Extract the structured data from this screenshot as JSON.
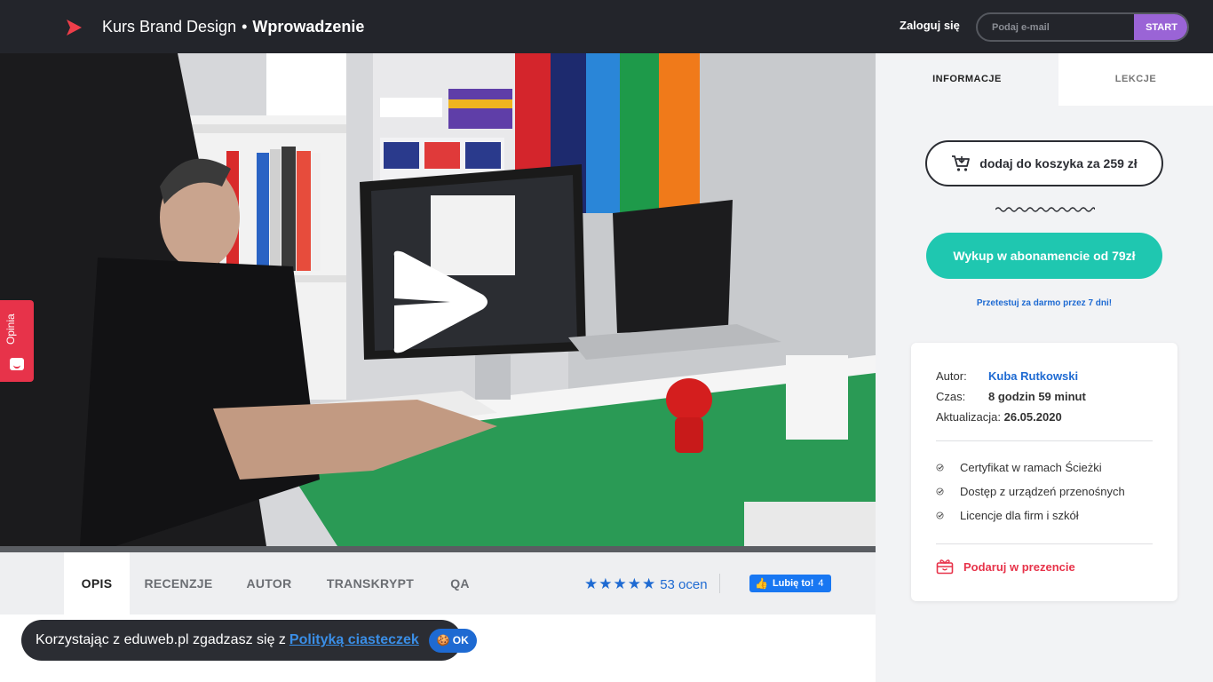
{
  "header": {
    "course_prefix": "Kurs Brand Design",
    "separator": "•",
    "course_section": "Wprowadzenie"
  },
  "auth": {
    "login_label": "Zaloguj się",
    "email_placeholder": "Podaj e-mail",
    "start_label": "START"
  },
  "video": {
    "play_icon": "play-icon"
  },
  "tabs": [
    {
      "label": "OPIS",
      "active": true
    },
    {
      "label": "RECENZJE",
      "active": false
    },
    {
      "label": "AUTOR",
      "active": false
    },
    {
      "label": "TRANSKRYPT",
      "active": false
    },
    {
      "label": "QA",
      "active": false
    }
  ],
  "rating": {
    "stars": "★★★★★",
    "count_text": "53 ocen"
  },
  "facebook": {
    "label": "Lubię to!",
    "count": "4"
  },
  "cookie": {
    "text": "Korzystając z eduweb.pl zgadzasz się z",
    "link": "Polityką ciasteczek",
    "ok_label": "OK"
  },
  "feedback": {
    "label": "Opinia"
  },
  "panel": {
    "tabs": {
      "info": "INFORMACJE",
      "lessons": "LEKCJE"
    },
    "cart_label": "dodaj do koszyka za 259 zł",
    "subscription_label": "Wykup w abonamencie od 79zł",
    "trial_text": "Przetestuj za darmo przez 7 dni!",
    "card": {
      "author_key": "Autor:",
      "author_value": "Kuba Rutkowski",
      "time_key": "Czas:",
      "time_value": "8 godzin 59 minut",
      "updated_key": "Aktualizacja:",
      "updated_value": "26.05.2020",
      "features": [
        "Certyfikat w ramach Ścieżki",
        "Dostęp z urządzeń przenośnych",
        "Licencje dla firm i szkół"
      ],
      "gift_label": "Podaruj w prezencie"
    }
  },
  "colors": {
    "dark": "#23252b",
    "accent_blue": "#1e6ad2",
    "teal": "#1fc7b0",
    "purple": "#9a64d6",
    "red": "#e7334a"
  }
}
